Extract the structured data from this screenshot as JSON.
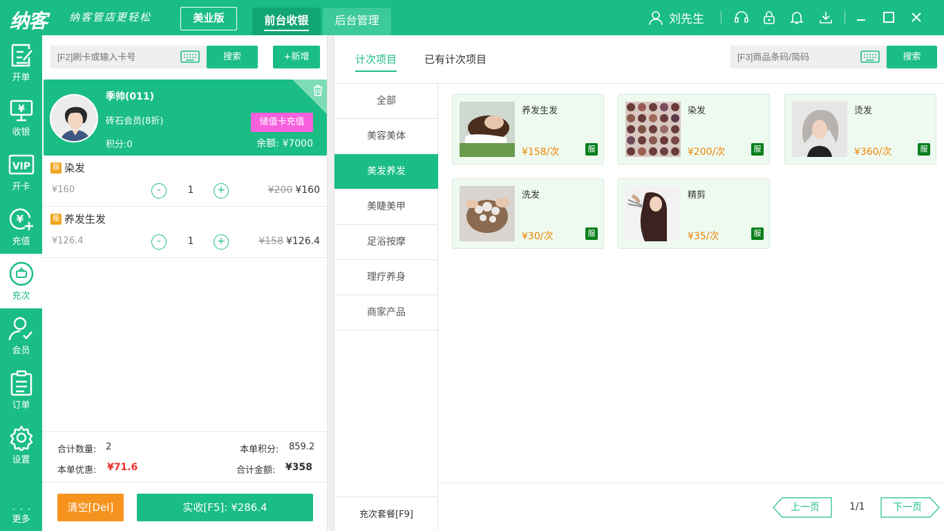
{
  "topbar": {
    "logo": "纳客",
    "slogan": "纳客管店更轻松",
    "edition": "美业版",
    "tabs": [
      {
        "label": "前台收银",
        "active": true
      },
      {
        "label": "后台管理",
        "active": false
      }
    ],
    "user_name": "刘先生"
  },
  "sidebar": {
    "items": [
      {
        "label": "开单",
        "icon": "edit-icon"
      },
      {
        "label": "收银",
        "icon": "cashier-icon"
      },
      {
        "label": "开卡",
        "icon": "vip-icon"
      },
      {
        "label": "充值",
        "icon": "recharge-icon"
      },
      {
        "label": "充次",
        "icon": "times-icon",
        "active": true
      },
      {
        "label": "会员",
        "icon": "member-icon"
      },
      {
        "label": "订单",
        "icon": "order-icon"
      },
      {
        "label": "设置",
        "icon": "gear-icon"
      },
      {
        "label": "更多",
        "icon": "more-icon"
      }
    ]
  },
  "left": {
    "card_placeholder": "[F2]刷卡或输入卡号",
    "search_label": "搜索",
    "add_label": "+新增",
    "member": {
      "name": "季帅(011)",
      "level": "砖石会员(8折)",
      "points": "积分:0",
      "recharge_label": "储值卡充值",
      "balance": "余额: ¥7000"
    },
    "items": [
      {
        "badge": "服",
        "name": "染发",
        "price": "¥160",
        "qty": "1",
        "orig": "¥200",
        "total": "¥160"
      },
      {
        "badge": "服",
        "name": "养发生发",
        "price": "¥126.4",
        "qty": "1",
        "orig": "¥158",
        "total": "¥126.4"
      }
    ],
    "summary": {
      "count_label": "合计数量:",
      "count": "2",
      "points_label": "本单积分:",
      "points": "859.2",
      "discount_label": "本单优惠:",
      "discount": "¥71.6",
      "total_label": "合计金额:",
      "total": "¥358"
    },
    "clear_label": "清空[Del]",
    "pay_label": "实收[F5]: ¥286.4"
  },
  "right": {
    "tabs": [
      {
        "label": "计次项目",
        "active": true
      },
      {
        "label": "已有计次项目",
        "active": false
      }
    ],
    "barcode_placeholder": "[F3]商品条码/简码",
    "search_label": "搜索",
    "categories": [
      "全部",
      "美容美体",
      "美发养发",
      "美睫美甲",
      "足浴按摩",
      "理疗养身",
      "商家产品"
    ],
    "active_category": "美发养发",
    "package_label": "充次套餐[F9]",
    "products": [
      {
        "name": "养发生发",
        "price": "¥158/次",
        "tag": "服"
      },
      {
        "name": "染发",
        "price": "¥200/次",
        "tag": "服"
      },
      {
        "name": "烫发",
        "price": "¥360/次",
        "tag": "服"
      },
      {
        "name": "洗发",
        "price": "¥30/次",
        "tag": "服"
      },
      {
        "name": "精剪",
        "price": "¥35/次",
        "tag": "服"
      }
    ],
    "pager": {
      "prev": "上一页",
      "page": "1/1",
      "next": "下一页"
    }
  },
  "colors": {
    "primary": "#1abd83",
    "orange": "#f6931f",
    "pink": "#f760dd",
    "red": "#e8312f"
  }
}
